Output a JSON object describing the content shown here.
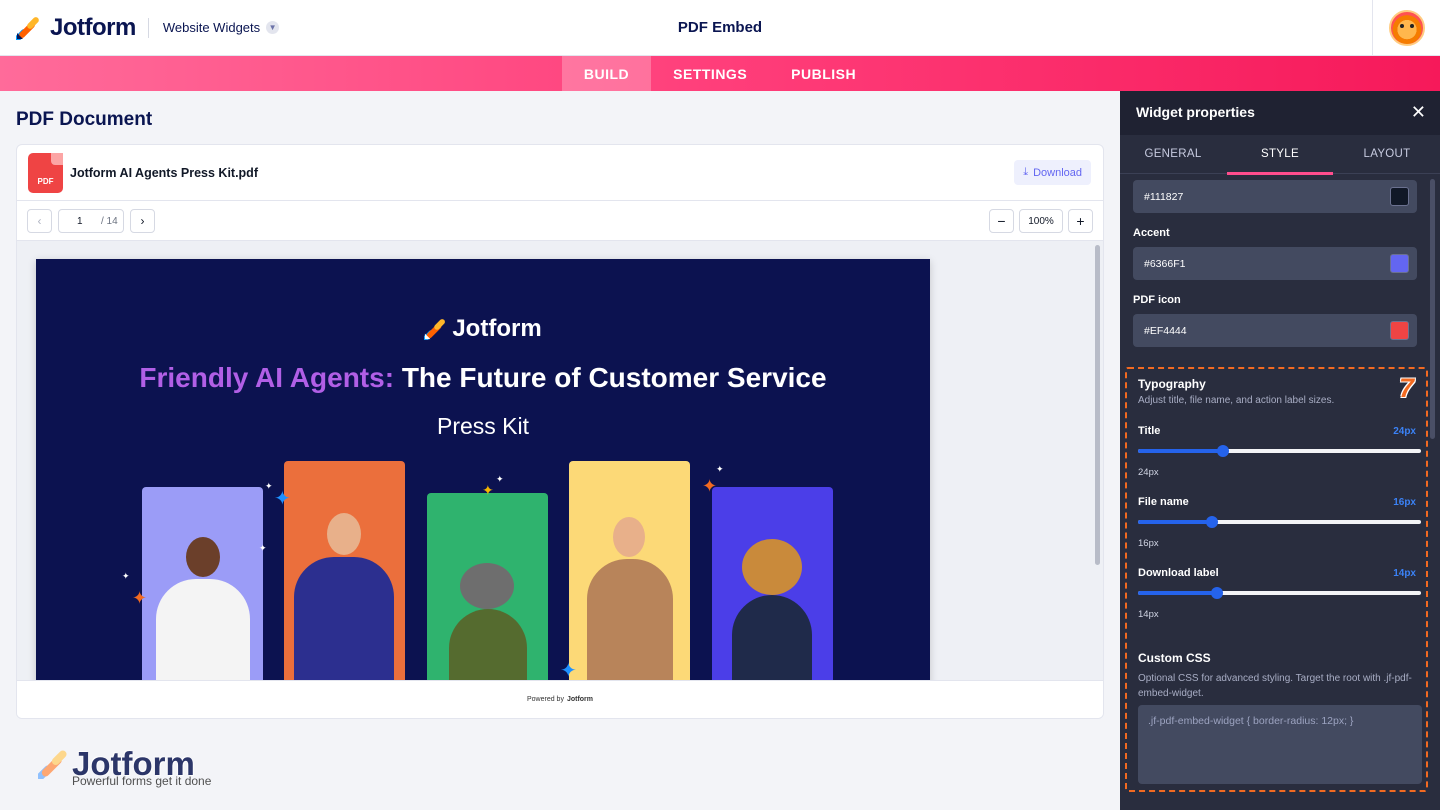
{
  "topbar": {
    "brand": "Jotform",
    "widget_selector": "Website Widgets",
    "app_title": "PDF Embed"
  },
  "nav": {
    "tabs": [
      {
        "label": "BUILD",
        "active": true
      },
      {
        "label": "SETTINGS",
        "active": false
      },
      {
        "label": "PUBLISH",
        "active": false
      }
    ]
  },
  "document": {
    "title": "PDF Document",
    "pdf_badge": "PDF",
    "file_name": "Jotform AI Agents Press Kit.pdf",
    "download_label": "Download",
    "current_page": "1",
    "total_pages": "/ 14",
    "zoom": "100%",
    "powered_by": "Powered by",
    "powered_brand": "Jotform"
  },
  "pdf_page": {
    "logo_text": "Jotform",
    "headline_accent": "Friendly AI Agents:",
    "headline_rest": "The Future of Customer Service",
    "subline": "Press Kit"
  },
  "watermark": {
    "brand": "Jotform",
    "tagline": "Powerful forms get it done"
  },
  "panel": {
    "title": "Widget properties",
    "tabs": [
      {
        "label": "GENERAL",
        "active": false
      },
      {
        "label": "STYLE",
        "active": true
      },
      {
        "label": "LAYOUT",
        "active": false
      }
    ],
    "colors": [
      {
        "label": "",
        "value": "#111827",
        "swatch": "#111827"
      },
      {
        "label": "Accent",
        "value": "#6366F1",
        "swatch": "#6366F1"
      },
      {
        "label": "PDF icon",
        "value": "#EF4444",
        "swatch": "#EF4444"
      }
    ],
    "typography": {
      "title": "Typography",
      "description": "Adjust title, file name, and action label sizes.",
      "badge": "7",
      "sliders": [
        {
          "label": "Title",
          "value": "24px",
          "sub": "24px",
          "fraction": 0.3
        },
        {
          "label": "File name",
          "value": "16px",
          "sub": "16px",
          "fraction": 0.26
        },
        {
          "label": "Download label",
          "value": "14px",
          "sub": "14px",
          "fraction": 0.28
        }
      ]
    },
    "custom_css": {
      "title": "Custom CSS",
      "description": "Optional CSS for advanced styling. Target the root with .jf-pdf-embed-widget.",
      "placeholder": ".jf-pdf-embed-widget { border-radius: 12px; }"
    }
  }
}
